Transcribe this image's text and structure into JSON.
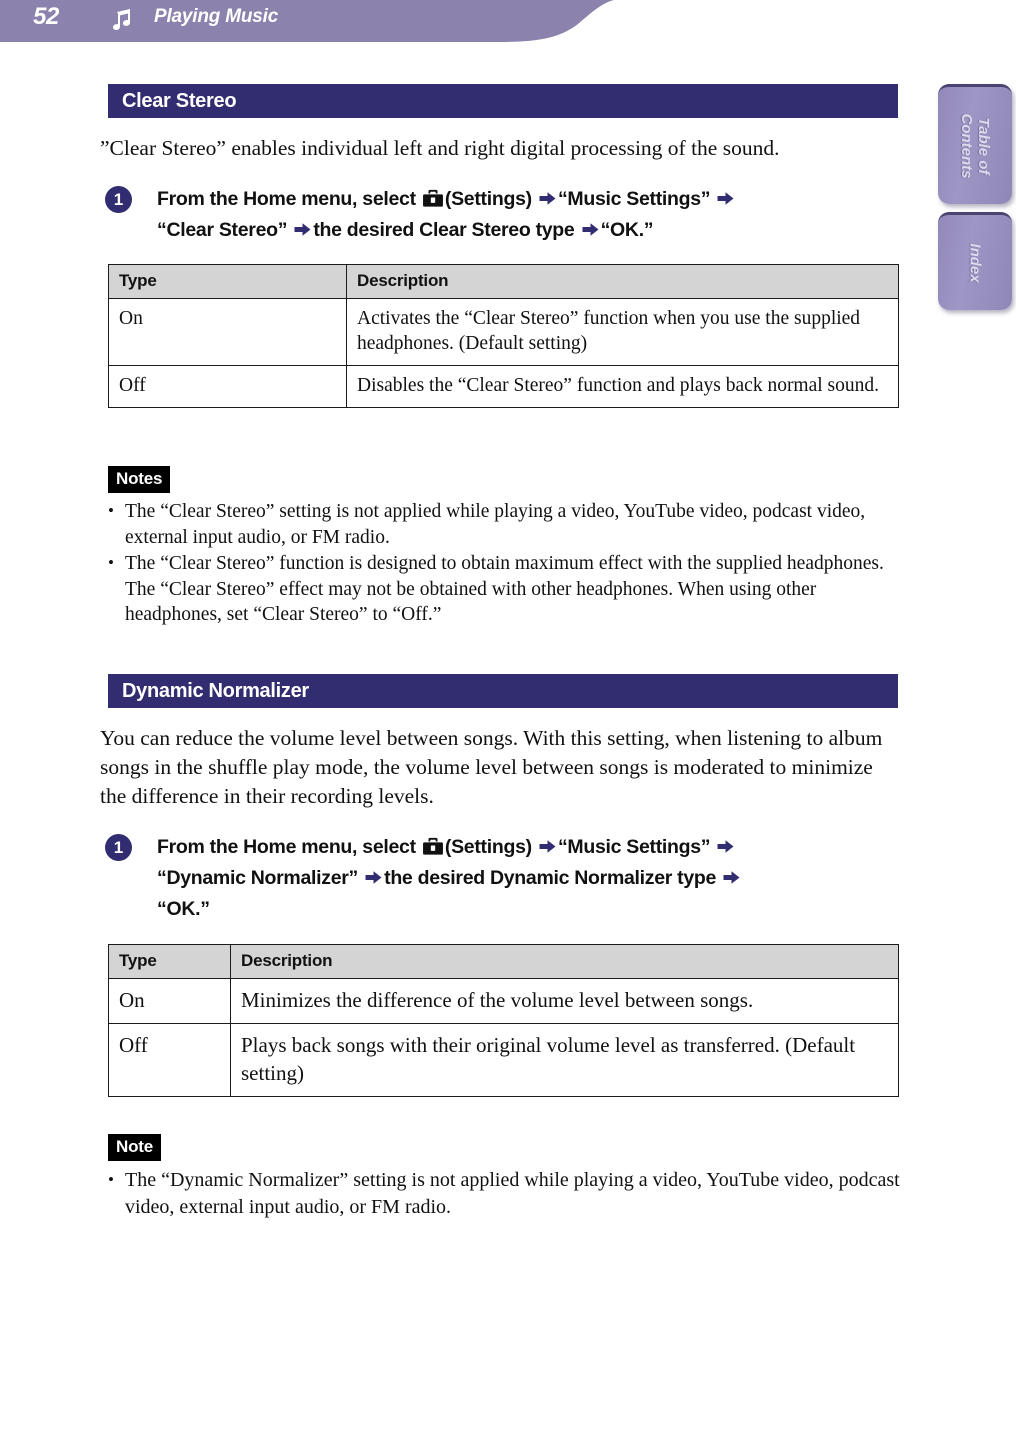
{
  "header": {
    "page_number": "52",
    "icon": "music-note-icon",
    "title": "Playing Music",
    "bar_color": "#8b82ad"
  },
  "side_tabs": [
    {
      "label": "Table of\nContents",
      "name": "table-of-contents"
    },
    {
      "label": "Index",
      "name": "index"
    }
  ],
  "side_tab_labels": {
    "toc_line1": "Table of",
    "toc_line2": "Contents",
    "index": "Index"
  },
  "theme": {
    "heading_bar": "#312d70",
    "table_header_gray": "#d4d4d4",
    "note_badge": "#000000",
    "accent": "#312d70"
  },
  "sections": [
    {
      "id": "clear-stereo",
      "heading": "Clear Stereo",
      "intro": "”Clear Stereo” enables individual left and right digital processing of the sound.",
      "step": {
        "number": "1",
        "line1_a": "From the Home menu, select",
        "settings_icon": "settings-toolbox-icon",
        "line1_b": "(Settings)",
        "line1_c": "“Music Settings”",
        "line2_a": "“Clear Stereo”",
        "line2_b": "the desired Clear Stereo type",
        "line2_c": "“OK.”"
      },
      "table": {
        "columns": [
          "Type",
          "Description"
        ],
        "rows": [
          [
            "On",
            "Activates the “Clear Stereo” function when you use the supplied headphones. (Default setting)"
          ],
          [
            "Off",
            "Disables the “Clear Stereo” function and plays back normal sound."
          ]
        ]
      },
      "notes": {
        "badge": "Notes",
        "items": [
          "The “Clear Stereo” setting is not applied while playing a video, YouTube video, podcast video, external input audio, or FM radio.",
          "The “Clear Stereo” function is designed to obtain maximum effect with the supplied headphones. The “Clear Stereo” effect may not be obtained with other headphones. When using other headphones, set “Clear Stereo” to “Off.”"
        ]
      }
    },
    {
      "id": "dynamic-normalizer",
      "heading": "Dynamic Normalizer",
      "intro": "You can reduce the volume level between songs. With this setting, when listening to album songs in the shuffle play mode, the volume level between songs is moderated to minimize the difference in their recording levels.",
      "step": {
        "number": "1",
        "line1_a": "From the Home menu, select",
        "settings_icon": "settings-toolbox-icon",
        "line1_b": "(Settings)",
        "line1_c": "“Music Settings”",
        "line2_a": "“Dynamic Normalizer”",
        "line2_b": "the desired Dynamic Normalizer type",
        "line3_a": "“OK.”"
      },
      "table": {
        "columns": [
          "Type",
          "Description"
        ],
        "rows": [
          [
            "On",
            "Minimizes the difference of the volume level between songs."
          ],
          [
            "Off",
            "Plays back songs with their original volume level as transferred. (Default setting)"
          ]
        ]
      },
      "notes": {
        "badge": "Note",
        "items": [
          "The “Dynamic Normalizer” setting is not applied while playing a video, YouTube video, podcast video, external input audio, or FM radio."
        ]
      }
    }
  ]
}
